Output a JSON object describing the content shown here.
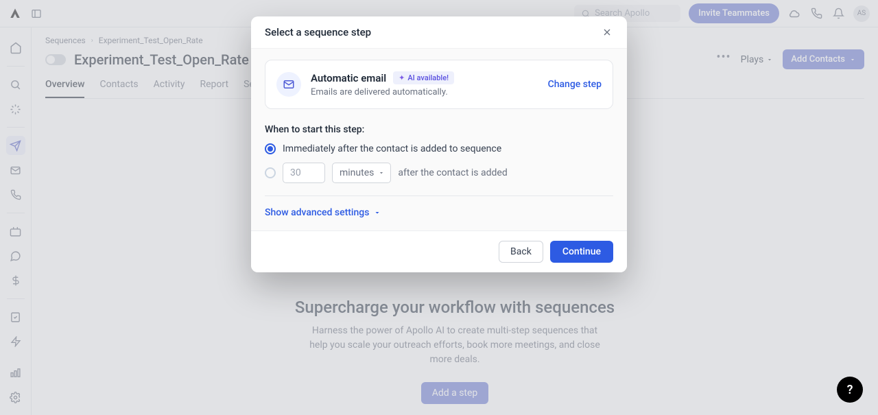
{
  "topbar": {
    "search_placeholder": "Search Apollo",
    "invite_label": "Invite Teammates",
    "avatar_initials": "AS"
  },
  "breadcrumbs": {
    "root": "Sequences",
    "current": "Experiment_Test_Open_Rate"
  },
  "page": {
    "title": "Experiment_Test_Open_Rate",
    "plays_label": "Plays",
    "add_contacts_label": "Add Contacts"
  },
  "tabs": {
    "overview": "Overview",
    "contacts": "Contacts",
    "activity": "Activity",
    "report": "Report",
    "settings": "Settings"
  },
  "hero": {
    "heading": "Supercharge your workflow with sequences",
    "body": "Harness the power of Apollo AI to create multi-step sequences that help you scale your outreach efforts, book more meetings, and close more deals.",
    "cta": "Add a step"
  },
  "modal": {
    "title": "Select a sequence step",
    "step_title": "Automatic email",
    "ai_badge": "AI available!",
    "step_sub": "Emails are delivered automatically.",
    "change_step": "Change step",
    "when_label": "When to start this step:",
    "option_immediate": "Immediately after the contact is added to sequence",
    "delay_value": "30",
    "delay_unit": "minutes",
    "delay_suffix": "after the contact is added",
    "advanced": "Show advanced settings",
    "back": "Back",
    "continue": "Continue"
  },
  "help": {
    "label": "?"
  }
}
